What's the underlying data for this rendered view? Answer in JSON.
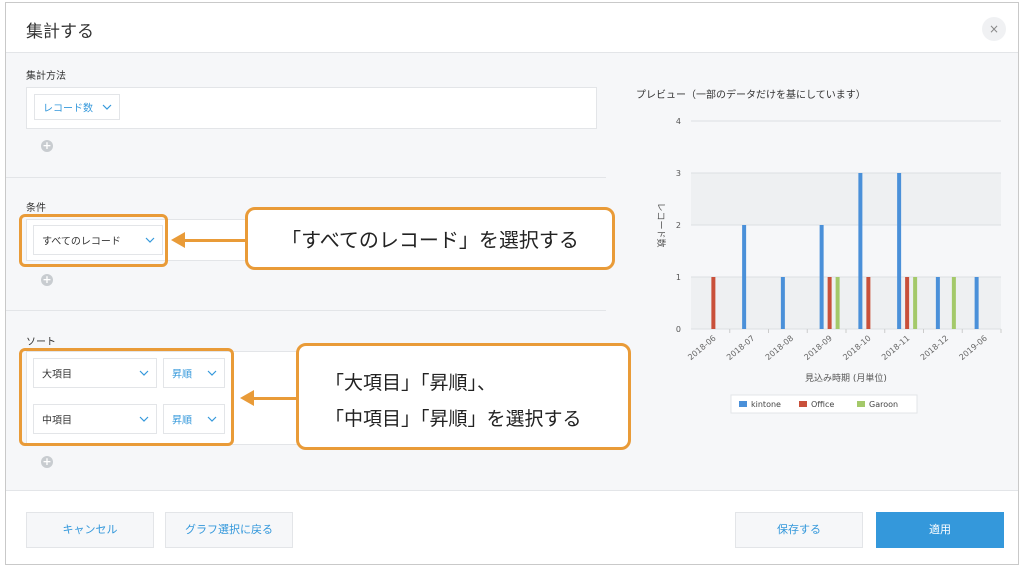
{
  "dialog": {
    "title": "集計する",
    "close_icon": "×"
  },
  "aggregation": {
    "label": "集計方法",
    "select_value": "レコード数"
  },
  "conditions": {
    "label": "条件",
    "select_value": "すべてのレコード"
  },
  "sort": {
    "label": "ソート",
    "rows": [
      {
        "field": "大項目",
        "order": "昇順"
      },
      {
        "field": "中項目",
        "order": "昇順"
      }
    ]
  },
  "callouts": {
    "condition": "「すべてのレコード」を選択する",
    "sort_line1": "「大項目」「昇順」、",
    "sort_line2": "「中項目」「昇順」を選択する"
  },
  "preview": {
    "title": "プレビュー（一部のデータだけを基にしています）"
  },
  "chart_data": {
    "type": "bar",
    "xlabel": "見込み時期 (月単位)",
    "ylabel": "レコード数",
    "ylim": [
      0,
      4
    ],
    "yticks": [
      0,
      1,
      2,
      3,
      4
    ],
    "grid": true,
    "legend_position": "bottom",
    "categories": [
      "2018-06",
      "2018-07",
      "2018-08",
      "2018-09",
      "2018-10",
      "2018-11",
      "2018-12",
      "2019-06"
    ],
    "series": [
      {
        "name": "kintone",
        "color": "#4a90d9",
        "values": [
          0,
          2,
          1,
          2,
          3,
          3,
          1,
          1
        ]
      },
      {
        "name": "Office",
        "color": "#c9503a",
        "values": [
          1,
          0,
          0,
          1,
          1,
          1,
          0,
          0
        ]
      },
      {
        "name": "Garoon",
        "color": "#a4c96a",
        "values": [
          0,
          0,
          0,
          1,
          0,
          1,
          1,
          0
        ]
      }
    ]
  },
  "footer": {
    "cancel": "キャンセル",
    "back": "グラフ選択に戻る",
    "save": "保存する",
    "apply": "適用"
  }
}
